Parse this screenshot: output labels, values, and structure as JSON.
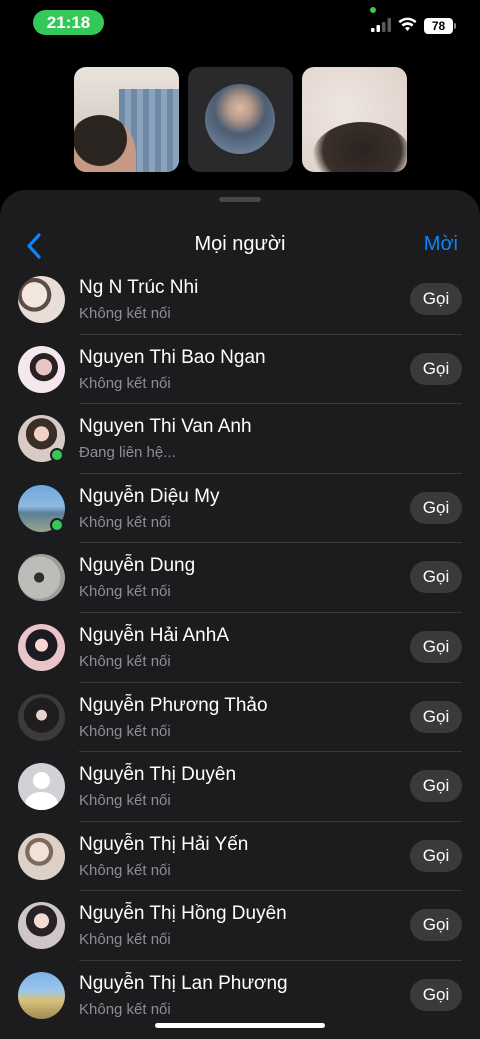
{
  "status_bar": {
    "time": "21:18",
    "battery": "78"
  },
  "call_tiles": [
    {
      "name": "participant-1"
    },
    {
      "name": "participant-2"
    },
    {
      "name": "participant-3"
    }
  ],
  "sheet": {
    "title": "Mọi người",
    "new_label": "Mời",
    "back_icon": "chevron-left-icon"
  },
  "contacts": [
    {
      "name": "Ng N Trúc Nhi",
      "status": "Không kết nối",
      "call_label": "Gọi",
      "online": false
    },
    {
      "name": "Nguyen Thi Bao Ngan",
      "status": "Không kết nối",
      "call_label": "Gọi",
      "online": false
    },
    {
      "name": "Nguyen Thi Van Anh",
      "status": "Đang liên hệ...",
      "call_label": "",
      "online": true
    },
    {
      "name": "Nguyễn Diệu My",
      "status": "Không kết nối",
      "call_label": "Gọi",
      "online": true
    },
    {
      "name": "Nguyễn Dung",
      "status": "Không kết nối",
      "call_label": "Gọi",
      "online": false
    },
    {
      "name": "Nguyễn Hải AnhA",
      "status": "Không kết nối",
      "call_label": "Gọi",
      "online": false
    },
    {
      "name": "Nguyễn Phương Thảo",
      "status": "Không kết nối",
      "call_label": "Gọi",
      "online": false
    },
    {
      "name": "Nguyễn Thị Duyên",
      "status": "Không kết nối",
      "call_label": "Gọi",
      "online": false
    },
    {
      "name": "Nguyễn Thị Hải Yến",
      "status": "Không kết nối",
      "call_label": "Gọi",
      "online": false
    },
    {
      "name": "Nguyễn Thị Hồng Duyên",
      "status": "Không kết nối",
      "call_label": "Gọi",
      "online": false
    },
    {
      "name": "Nguyễn Thị Lan Phương",
      "status": "Không kết nối",
      "call_label": "Gọi",
      "online": false
    }
  ],
  "colors": {
    "accent": "#0a84ff",
    "online": "#34c759",
    "sheet_bg": "#1c1c1e",
    "secondary_text": "#8e8e93"
  }
}
